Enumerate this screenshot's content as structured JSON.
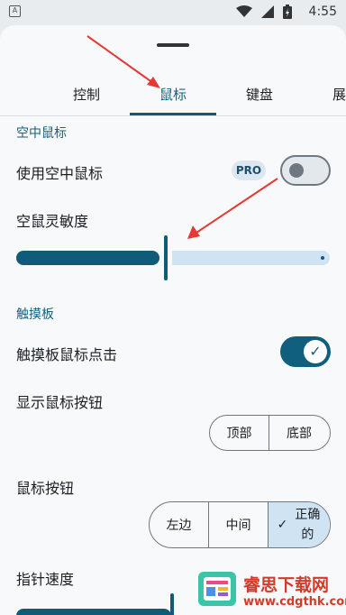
{
  "status_bar": {
    "app_icon_letter": "A",
    "time": "4:55",
    "icons": [
      "wifi-icon",
      "signal-icon",
      "battery-icon"
    ]
  },
  "tabs": [
    {
      "label": "控制"
    },
    {
      "label": "鼠标",
      "active": true
    },
    {
      "label": "键盘"
    },
    {
      "label": "展"
    }
  ],
  "air_mouse": {
    "section_title": "空中鼠标",
    "use_air_mouse_label": "使用空中鼠标",
    "pro_badge": "PRO",
    "toggle_on": false,
    "sensitivity_label": "空鼠灵敏度",
    "sensitivity_fraction": 0.47
  },
  "touchpad": {
    "section_title": "触摸板",
    "click_label": "触摸板鼠标点击",
    "toggle_on": true,
    "show_buttons_label": "显示鼠标按钮",
    "position_options": [
      "顶部",
      "底部"
    ],
    "mouse_buttons_label": "鼠标按钮",
    "button_options": [
      "左边",
      "中间",
      "正确的"
    ],
    "selected_button": "正确的",
    "pointer_speed_label": "指针速度",
    "pointer_speed_fraction": 0.5
  },
  "watermark": {
    "line1": "睿思下载网",
    "line2": "www.cdgthk.com"
  },
  "colors": {
    "accent": "#0f5b78",
    "accent_light": "#cfe3f3",
    "annotation_arrow": "#e53935"
  }
}
